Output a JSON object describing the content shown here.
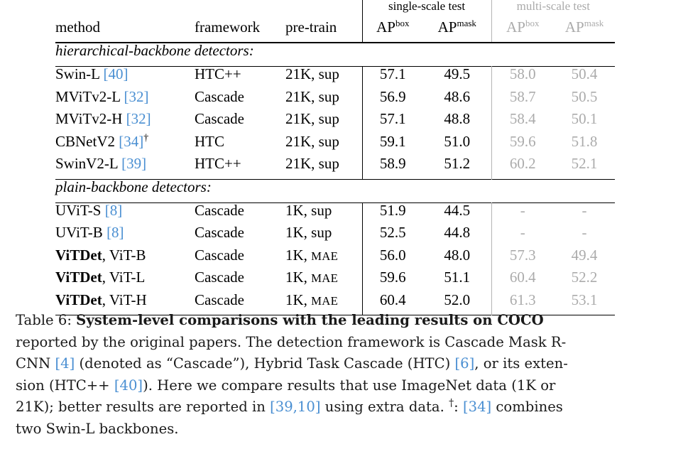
{
  "table": {
    "group_headers": {
      "single_scale": "single-scale test",
      "multi_scale": "multi-scale test"
    },
    "columns": {
      "method": "method",
      "framework": "framework",
      "pretrain": "pre-train",
      "ss_box_base": "AP",
      "ss_box_sup": "box",
      "ss_mask_base": "AP",
      "ss_mask_sup": "mask",
      "ms_box_base": "AP",
      "ms_box_sup": "box",
      "ms_mask_base": "AP",
      "ms_mask_sup": "mask"
    },
    "sections": [
      {
        "heading": "hierarchical-backbone detectors:",
        "rows": [
          {
            "method_name": "Swin-L ",
            "method_cite": "[40]",
            "method_dagger": "",
            "framework": "HTC++",
            "pretrain_head": "21K, ",
            "pretrain_tail": "sup",
            "pretrain_tail_sc": false,
            "ss_box": "57.1",
            "ss_mask": "49.5",
            "ms_box": "58.0",
            "ms_mask": "50.4",
            "bold": false
          },
          {
            "method_name": "MViTv2-L ",
            "method_cite": "[32]",
            "method_dagger": "",
            "framework": "Cascade",
            "pretrain_head": "21K, ",
            "pretrain_tail": "sup",
            "pretrain_tail_sc": false,
            "ss_box": "56.9",
            "ss_mask": "48.6",
            "ms_box": "58.7",
            "ms_mask": "50.5",
            "bold": false
          },
          {
            "method_name": "MViTv2-H ",
            "method_cite": "[32]",
            "method_dagger": "",
            "framework": "Cascade",
            "pretrain_head": "21K, ",
            "pretrain_tail": "sup",
            "pretrain_tail_sc": false,
            "ss_box": "57.1",
            "ss_mask": "48.8",
            "ms_box": "58.4",
            "ms_mask": "50.1",
            "bold": false
          },
          {
            "method_name": "CBNetV2 ",
            "method_cite": "[34]",
            "method_dagger": "†",
            "framework": "HTC",
            "pretrain_head": "21K, ",
            "pretrain_tail": "sup",
            "pretrain_tail_sc": false,
            "ss_box": "59.1",
            "ss_mask": "51.0",
            "ms_box": "59.6",
            "ms_mask": "51.8",
            "bold": false
          },
          {
            "method_name": "SwinV2-L ",
            "method_cite": "[39]",
            "method_dagger": "",
            "framework": "HTC++",
            "pretrain_head": "21K, ",
            "pretrain_tail": "sup",
            "pretrain_tail_sc": false,
            "ss_box": "58.9",
            "ss_mask": "51.2",
            "ms_box": "60.2",
            "ms_mask": "52.1",
            "bold": false
          }
        ]
      },
      {
        "heading": "plain-backbone detectors:",
        "rows": [
          {
            "method_name": "UViT-S ",
            "method_cite": "[8]",
            "method_dagger": "",
            "framework": "Cascade",
            "pretrain_head": "1K, ",
            "pretrain_tail": "sup",
            "pretrain_tail_sc": false,
            "ss_box": "51.9",
            "ss_mask": "44.5",
            "ms_box": "-",
            "ms_mask": "-",
            "bold": false
          },
          {
            "method_name": "UViT-B ",
            "method_cite": "[8]",
            "method_dagger": "",
            "framework": "Cascade",
            "pretrain_head": "1K, ",
            "pretrain_tail": "sup",
            "pretrain_tail_sc": false,
            "ss_box": "52.5",
            "ss_mask": "44.8",
            "ms_box": "-",
            "ms_mask": "-",
            "bold": false
          },
          {
            "method_bold": "ViTDet",
            "method_name": ", ViT-B",
            "method_cite": "",
            "method_dagger": "",
            "framework": "Cascade",
            "pretrain_head": "1K, ",
            "pretrain_tail": "MAE",
            "pretrain_tail_sc": true,
            "ss_box": "56.0",
            "ss_mask": "48.0",
            "ms_box": "57.3",
            "ms_mask": "49.4",
            "bold": false
          },
          {
            "method_bold": "ViTDet",
            "method_name": ", ViT-L",
            "method_cite": "",
            "method_dagger": "",
            "framework": "Cascade",
            "pretrain_head": "1K, ",
            "pretrain_tail": "MAE",
            "pretrain_tail_sc": true,
            "ss_box": "59.6",
            "ss_mask": "51.1",
            "ms_box": "60.4",
            "ms_mask": "52.2",
            "bold": false
          },
          {
            "method_bold": "ViTDet",
            "method_name": ", ViT-H",
            "method_cite": "",
            "method_dagger": "",
            "framework": "Cascade",
            "pretrain_head": "1K, ",
            "pretrain_tail": "MAE",
            "pretrain_tail_sc": true,
            "ss_box": "60.4",
            "ss_mask": "52.0",
            "ms_box": "61.3",
            "ms_mask": "53.1",
            "bold": true
          }
        ]
      }
    ]
  },
  "caption": {
    "label": "Table 6: ",
    "bold_part": "System-level comparisons with the leading results on COCO",
    "line1_rest": "",
    "line2_a": "reported by the original papers. The detection framework is Cascade Mask R-",
    "line3_a": "CNN ",
    "line3_cite1": "[4]",
    "line3_b": " (denoted as “Cascade”), Hybrid Task Cascade (HTC) ",
    "line3_cite2": "[6]",
    "line3_c": ", or its exten-",
    "line4_a": "sion (HTC++ ",
    "line4_cite1": "[40]",
    "line4_b": "). Here we compare results that use ImageNet data (1K or",
    "line5_a": "21K); better results are reported in ",
    "line5_cite1": "[39,10]",
    "line5_b": " using extra data. ",
    "line5_dagger": "†",
    "line5_c": ": ",
    "line5_cite2": "[34]",
    "line5_d": " combines",
    "line6": "two Swin-L backbones."
  },
  "colors": {
    "citation_blue": "#4a8fd2",
    "gray_text": "#ababab",
    "rule_black": "#000000"
  }
}
